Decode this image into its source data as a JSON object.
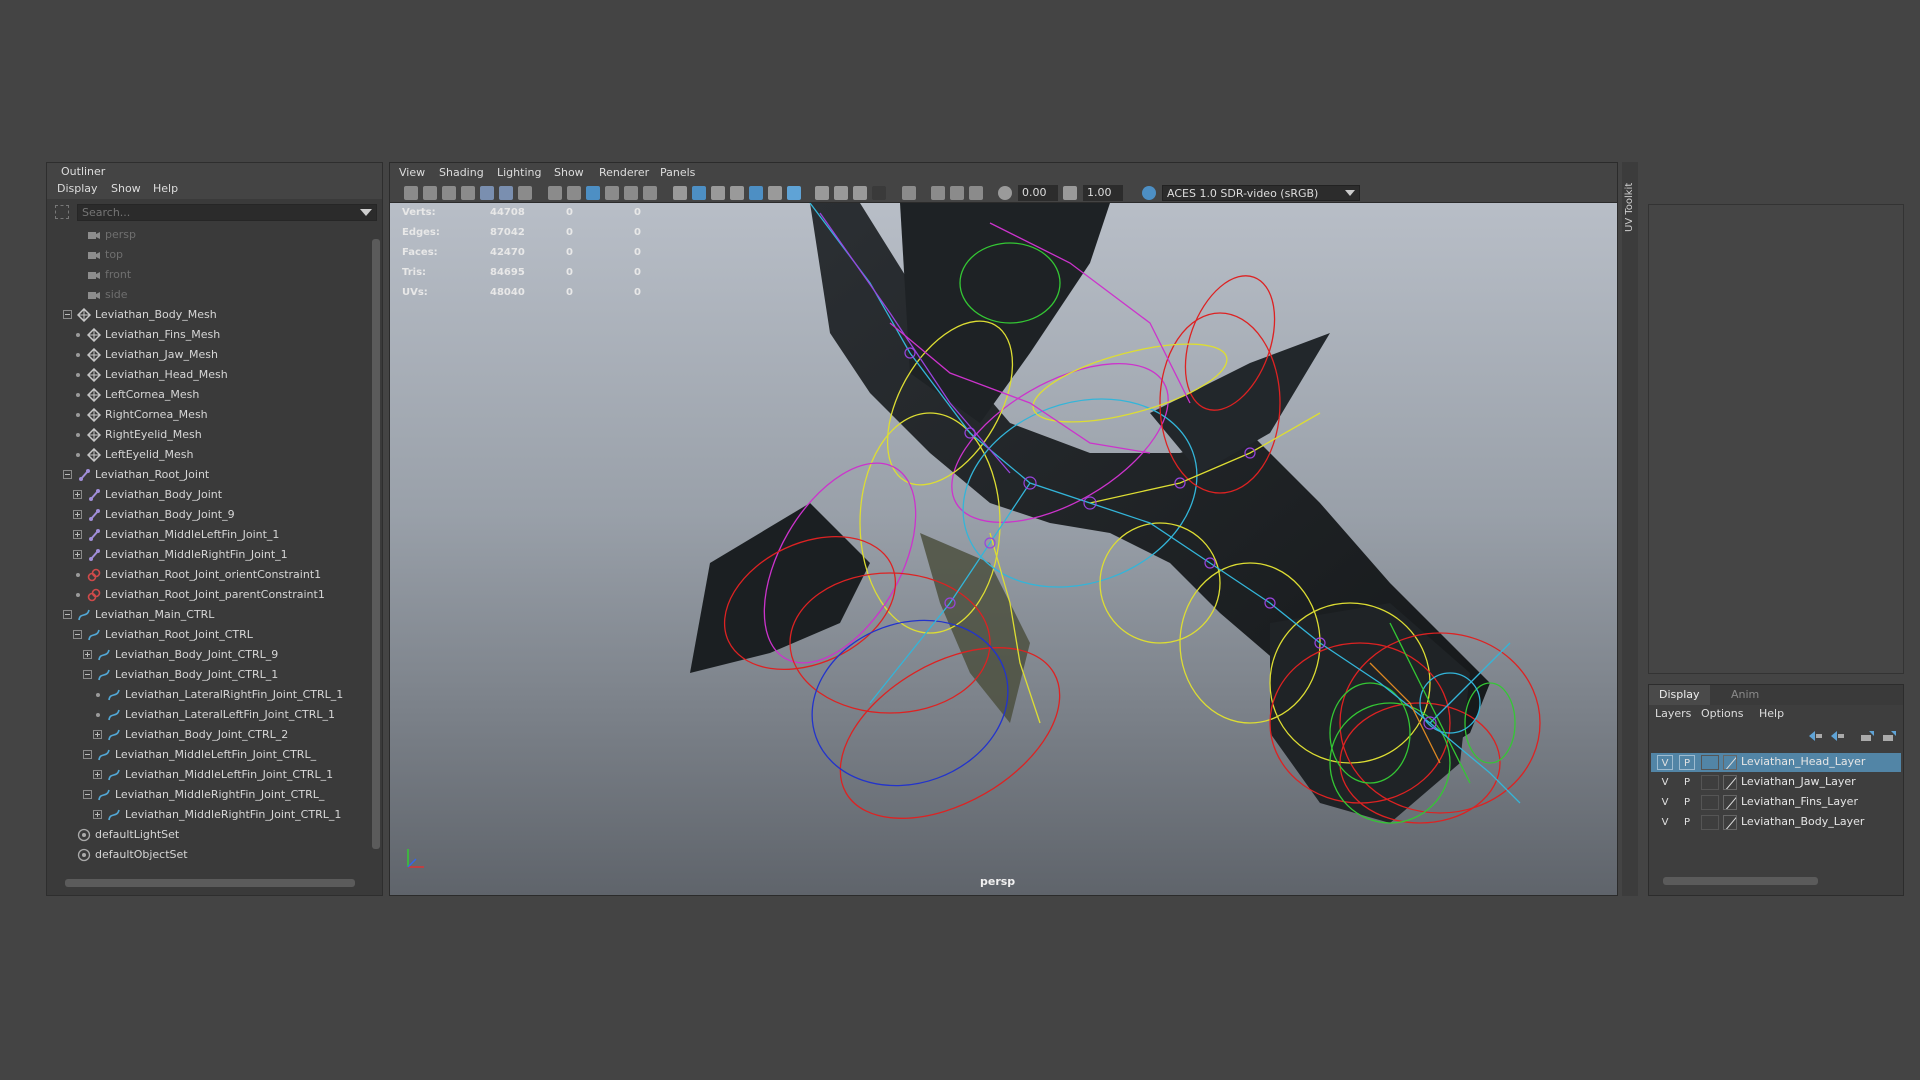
{
  "outliner": {
    "title": "Outliner",
    "menu": [
      "Display",
      "Show",
      "Help"
    ],
    "search_placeholder": "Search...",
    "items": [
      {
        "label": "persp",
        "type": "camera",
        "dim": true
      },
      {
        "label": "top",
        "type": "camera",
        "dim": true
      },
      {
        "label": "front",
        "type": "camera",
        "dim": true
      },
      {
        "label": "side",
        "type": "camera",
        "dim": true
      },
      {
        "label": "Leviathan_Body_Mesh",
        "type": "mesh"
      },
      {
        "label": "Leviathan_Fins_Mesh",
        "type": "mesh"
      },
      {
        "label": "Leviathan_Jaw_Mesh",
        "type": "mesh"
      },
      {
        "label": "Leviathan_Head_Mesh",
        "type": "mesh"
      },
      {
        "label": "LeftCornea_Mesh",
        "type": "mesh"
      },
      {
        "label": "RightCornea_Mesh",
        "type": "mesh"
      },
      {
        "label": "RightEyelid_Mesh",
        "type": "mesh"
      },
      {
        "label": "LeftEyelid_Mesh",
        "type": "mesh"
      },
      {
        "label": "Leviathan_Root_Joint",
        "type": "joint"
      },
      {
        "label": "Leviathan_Body_Joint",
        "type": "joint"
      },
      {
        "label": "Leviathan_Body_Joint_9",
        "type": "joint"
      },
      {
        "label": "Leviathan_MiddleLeftFin_Joint_1",
        "type": "joint"
      },
      {
        "label": "Leviathan_MiddleRightFin_Joint_1",
        "type": "joint"
      },
      {
        "label": "Leviathan_Root_Joint_orientConstraint1",
        "type": "constraint"
      },
      {
        "label": "Leviathan_Root_Joint_parentConstraint1",
        "type": "constraint"
      },
      {
        "label": "Leviathan_Main_CTRL",
        "type": "curve"
      },
      {
        "label": "Leviathan_Root_Joint_CTRL",
        "type": "curve"
      },
      {
        "label": "Leviathan_Body_Joint_CTRL_9",
        "type": "curve"
      },
      {
        "label": "Leviathan_Body_Joint_CTRL_1",
        "type": "curve"
      },
      {
        "label": "Leviathan_LateralRightFin_Joint_CTRL_1",
        "type": "curve"
      },
      {
        "label": "Leviathan_LateralLeftFin_Joint_CTRL_1",
        "type": "curve"
      },
      {
        "label": "Leviathan_Body_Joint_CTRL_2",
        "type": "curve"
      },
      {
        "label": "Leviathan_MiddleLeftFin_Joint_CTRL_",
        "type": "curve"
      },
      {
        "label": "Leviathan_MiddleLeftFin_Joint_CTRL_1",
        "type": "curve"
      },
      {
        "label": "Leviathan_MiddleRightFin_Joint_CTRL_",
        "type": "curve"
      },
      {
        "label": "Leviathan_MiddleRightFin_Joint_CTRL_1",
        "type": "curve"
      },
      {
        "label": "defaultLightSet",
        "type": "set"
      },
      {
        "label": "defaultObjectSet",
        "type": "set"
      }
    ]
  },
  "viewport": {
    "menu": [
      "View",
      "Shading",
      "Lighting",
      "Show",
      "Renderer",
      "Panels"
    ],
    "exposure": "0.00",
    "gamma": "1.00",
    "color_space": "ACES 1.0 SDR-video (sRGB)",
    "camera_label": "persp",
    "hud": [
      {
        "label": "Verts:",
        "value": "44708",
        "sel": "0",
        "comp": "0"
      },
      {
        "label": "Edges:",
        "value": "87042",
        "sel": "0",
        "comp": "0"
      },
      {
        "label": "Faces:",
        "value": "42470",
        "sel": "0",
        "comp": "0"
      },
      {
        "label": "Tris:",
        "value": "84695",
        "sel": "0",
        "comp": "0"
      },
      {
        "label": "UVs:",
        "value": "48040",
        "sel": "0",
        "comp": "0"
      }
    ]
  },
  "uv_toolkit": {
    "label": "UV Toolkit"
  },
  "layer_editor": {
    "tabs": [
      "Display",
      "Anim"
    ],
    "menu": [
      "Layers",
      "Options",
      "Help"
    ],
    "layers": [
      {
        "v": "V",
        "p": "P",
        "name": "Leviathan_Head_Layer",
        "selected": true
      },
      {
        "v": "V",
        "p": "P",
        "name": "Leviathan_Jaw_Layer",
        "selected": false
      },
      {
        "v": "V",
        "p": "P",
        "name": "Leviathan_Fins_Layer",
        "selected": false
      },
      {
        "v": "V",
        "p": "P",
        "name": "Leviathan_Body_Layer",
        "selected": false
      }
    ]
  },
  "colors": {
    "background": "#444444",
    "panel": "#3a3a3a",
    "selection": "#5285a6",
    "viewport_top": "#b8bec7",
    "viewport_bottom": "#5f646b"
  }
}
